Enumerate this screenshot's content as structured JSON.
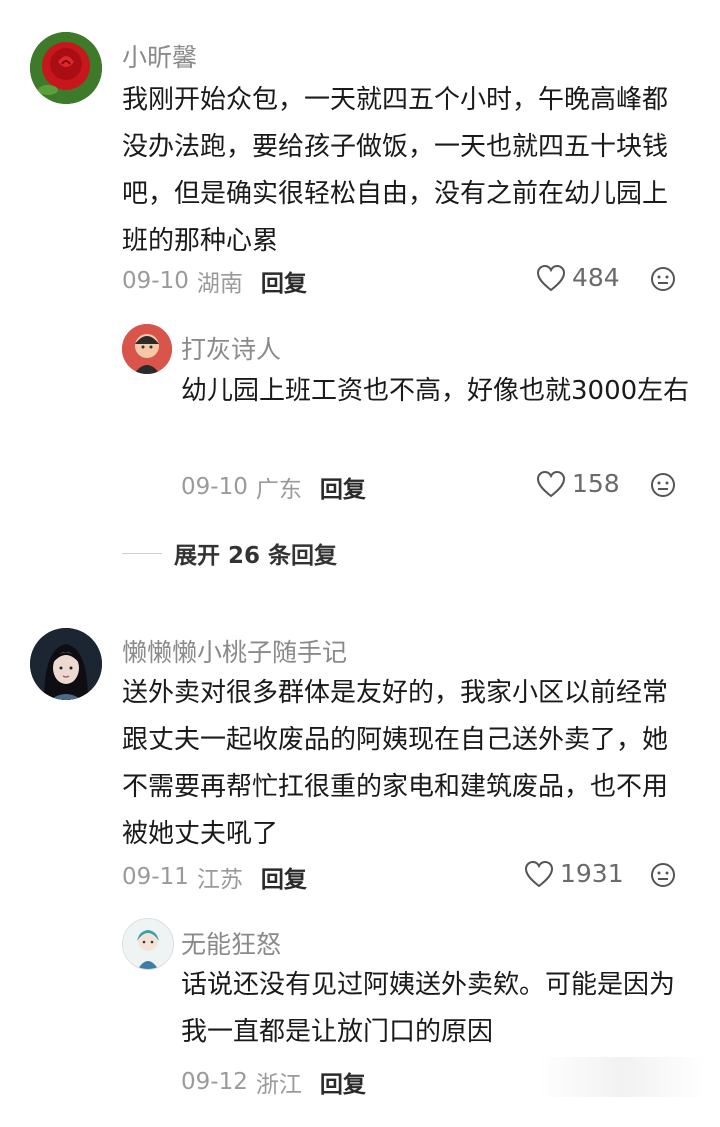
{
  "comments": [
    {
      "username": "小昕馨",
      "text": "我刚开始众包，一天就四五个小时，午晚高峰都没办法跑，要给孩子做饭，一天也就四五十块钱吧，但是确实很轻松自由，没有之前在幼儿园上班的那种心累",
      "date": "09-10",
      "location": "湖南",
      "reply_label": "回复",
      "likes": "484",
      "avatar_icon": "rose-avatar",
      "replies": [
        {
          "username": "打灰诗人",
          "text": "幼儿园上班工资也不高，好像也就3000左右",
          "date": "09-10",
          "location": "广东",
          "reply_label": "回复",
          "likes": "158",
          "avatar_icon": "cartoon-avatar"
        }
      ],
      "expand_label": "展开 26 条回复"
    },
    {
      "username": "懒懒懒小桃子随手记",
      "text": "送外卖对很多群体是友好的，我家小区以前经常跟丈夫一起收废品的阿姨现在自己送外卖了，她不需要再帮忙扛很重的家电和建筑废品，也不用被她丈夫吼了",
      "date": "09-11",
      "location": "江苏",
      "reply_label": "回复",
      "likes": "1931",
      "avatar_icon": "portrait-avatar",
      "replies": [
        {
          "username": "无能狂怒",
          "text": "话说还没有见过阿姨送外卖欸。可能是因为我一直都是让放门口的原因",
          "date": "09-12",
          "location": "浙江",
          "reply_label": "回复",
          "avatar_icon": "anime-avatar"
        }
      ]
    }
  ],
  "colors": {
    "username": "#8a8a8a",
    "meta": "#9a9a9a",
    "text": "#1a1a1a"
  }
}
